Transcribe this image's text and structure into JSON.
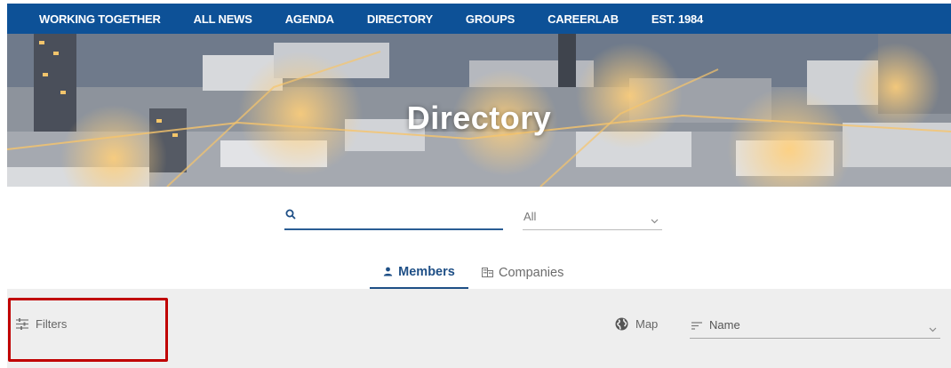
{
  "nav": {
    "items": [
      {
        "label": "WORKING TOGETHER"
      },
      {
        "label": "ALL NEWS"
      },
      {
        "label": "AGENDA"
      },
      {
        "label": "DIRECTORY"
      },
      {
        "label": "GROUPS"
      },
      {
        "label": "CAREERLAB"
      },
      {
        "label": "EST. 1984"
      }
    ]
  },
  "hero": {
    "title": "Directory"
  },
  "search": {
    "value": "",
    "placeholder": ""
  },
  "scope_select": {
    "value": "All"
  },
  "tabs": [
    {
      "label": "Members",
      "icon": "person-icon",
      "active": true
    },
    {
      "label": "Companies",
      "icon": "building-icon",
      "active": false
    }
  ],
  "toolbar": {
    "filters_label": "Filters",
    "map_label": "Map",
    "sort": {
      "value": "Name"
    }
  },
  "colors": {
    "nav_bg": "#0d5197",
    "accent": "#1e4f86",
    "toolbar_bg": "#eeeeee",
    "highlight": "#c00000"
  }
}
